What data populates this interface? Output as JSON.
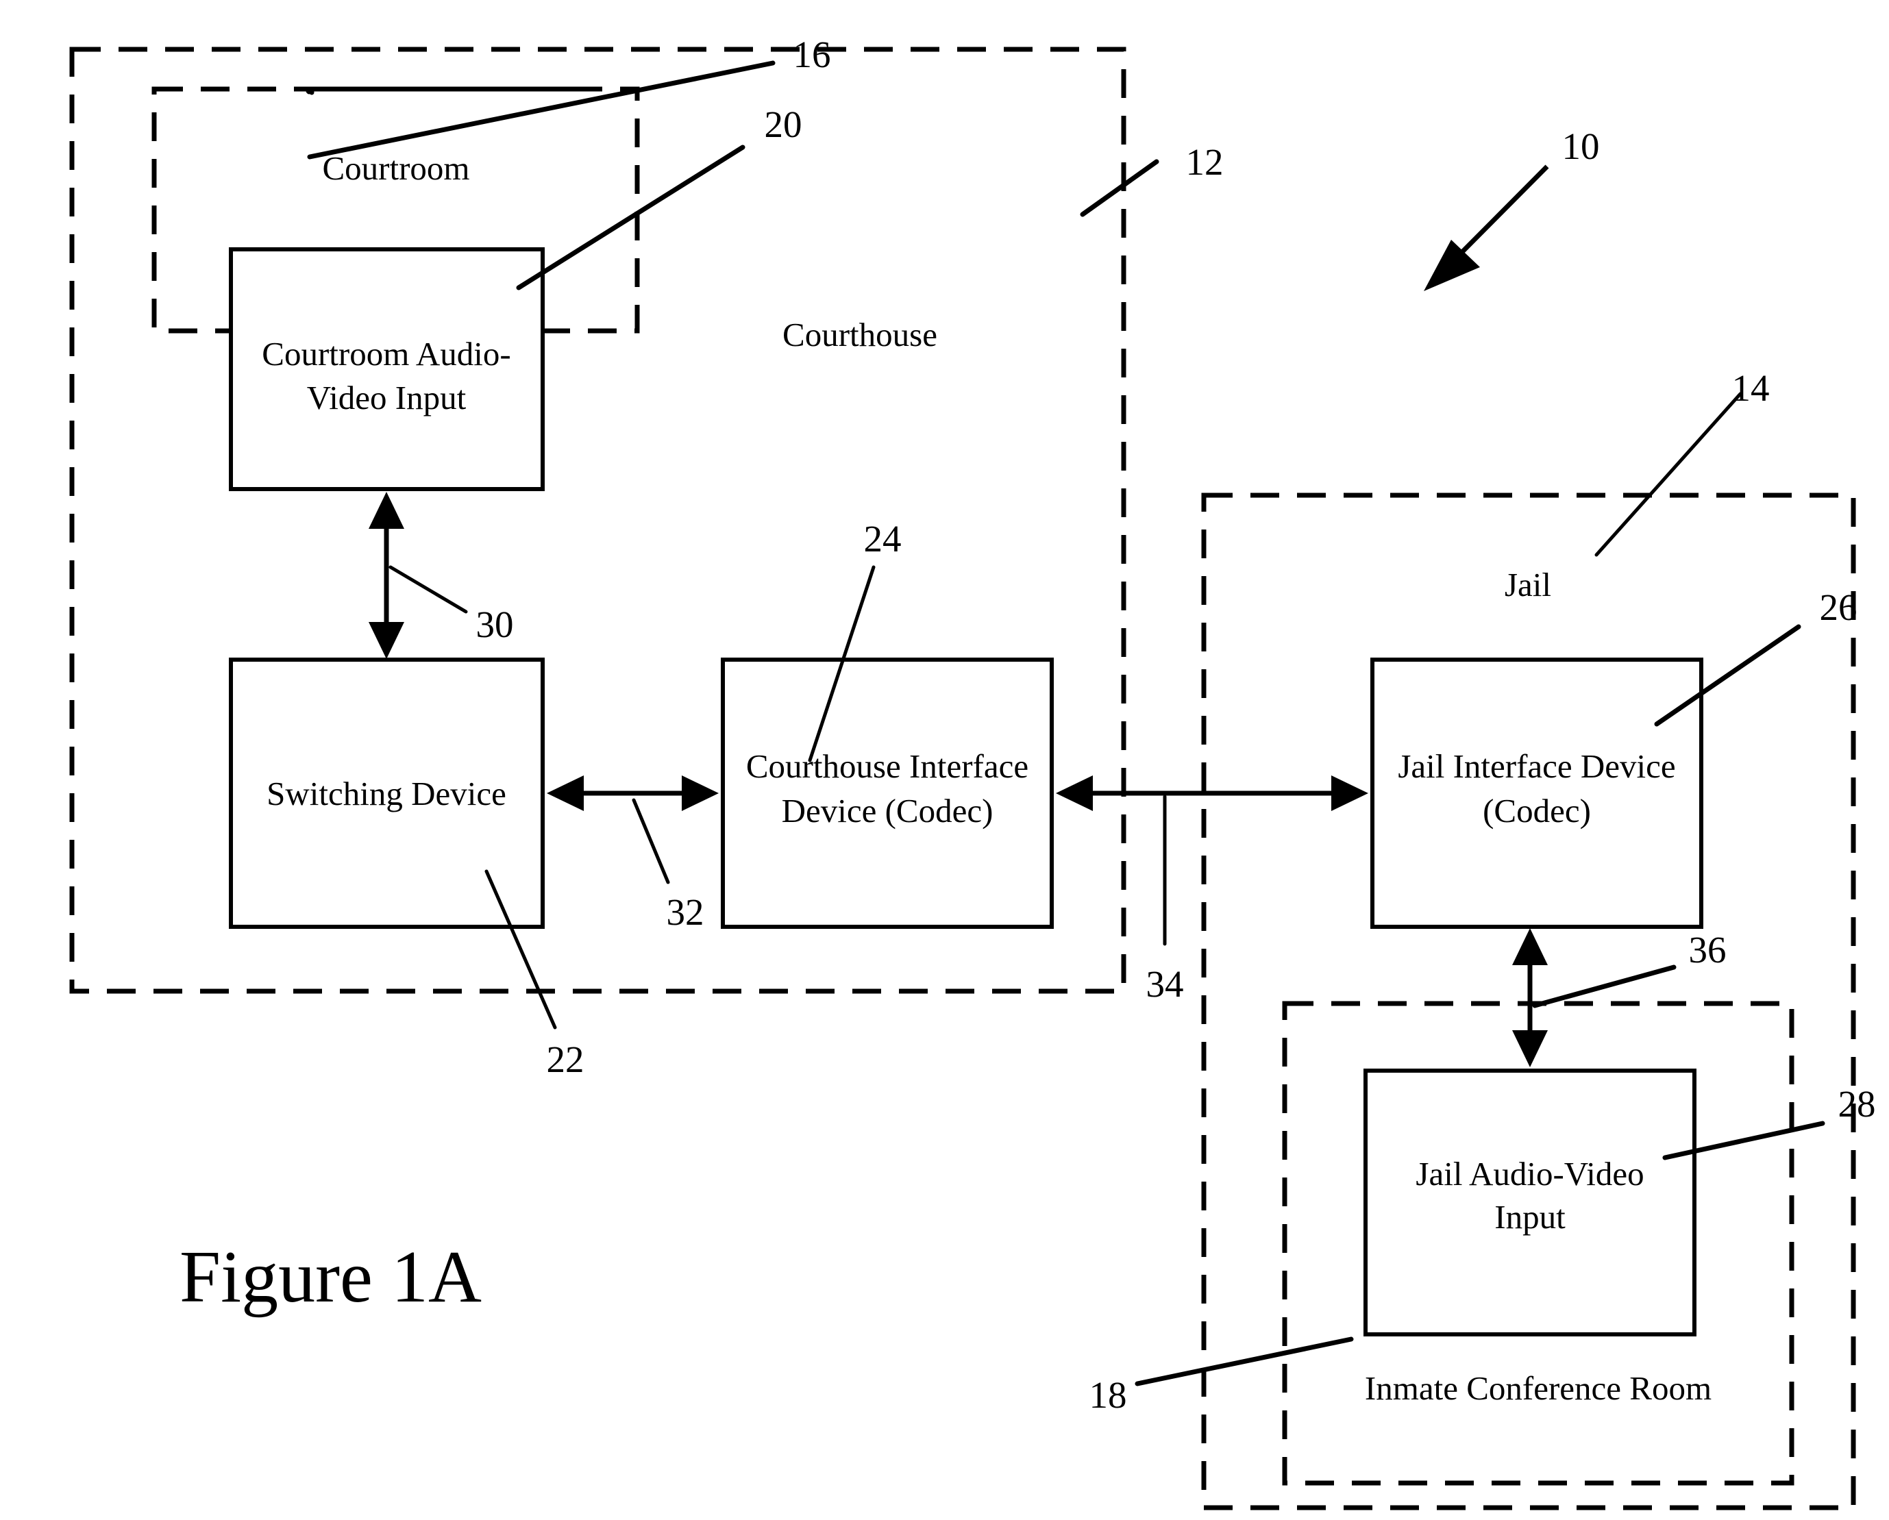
{
  "figure": {
    "caption": "Figure 1A"
  },
  "regions": [
    {
      "id": "courthouse",
      "label": "Courthouse",
      "ref": "12"
    },
    {
      "id": "courtroom",
      "label": "Courtroom",
      "ref": "16"
    },
    {
      "id": "jail",
      "label": "Jail",
      "ref": "14"
    },
    {
      "id": "inmate-conference-room",
      "label": "Inmate Conference Room",
      "ref": "18"
    }
  ],
  "boxes": [
    {
      "id": "courtroom-av-input",
      "line1": "Courtroom Audio-",
      "line2": "Video Input",
      "ref": "20"
    },
    {
      "id": "switching-device",
      "line1": "Switching Device",
      "line2": "",
      "ref": "22"
    },
    {
      "id": "courthouse-interface-device",
      "line1": "Courthouse Interface",
      "line2": "Device (Codec)",
      "ref": "24"
    },
    {
      "id": "jail-interface-device",
      "line1": "Jail Interface Device",
      "line2": "(Codec)",
      "ref": "26"
    },
    {
      "id": "jail-av-input",
      "line1": "Jail Audio-Video",
      "line2": "Input",
      "ref": "28"
    }
  ],
  "connections": [
    {
      "id": "courtroom-av-to-switching",
      "ref": "30"
    },
    {
      "id": "switching-to-courthouse-codec",
      "ref": "32"
    },
    {
      "id": "courthouse-codec-to-jail-codec",
      "ref": "34"
    },
    {
      "id": "jail-codec-to-jail-av",
      "ref": "36"
    }
  ],
  "system": {
    "ref": "10"
  },
  "colors": {
    "stroke": "#000000",
    "background": "#ffffff"
  }
}
